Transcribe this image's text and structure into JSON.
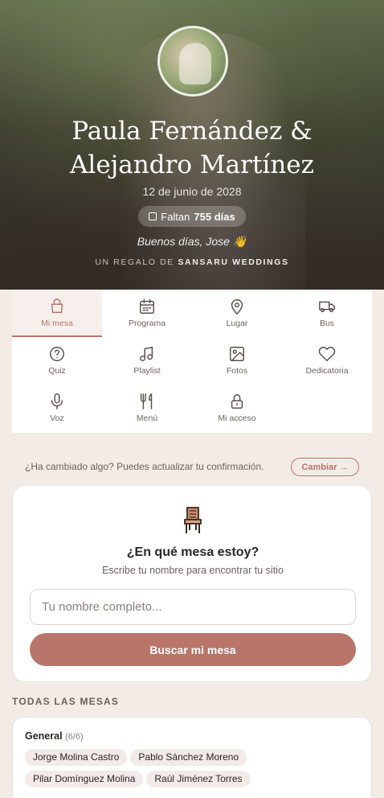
{
  "hero": {
    "couple_names": "Paula Fernández & Alejandro Martínez",
    "date": "12 de junio de 2028",
    "countdown_prefix": "Faltan",
    "countdown_value": "755 días",
    "greeting": "Buenos días, Jose 👋",
    "gift_prefix": "UN REGALO DE",
    "gift_brand": "SANSARU WEDDINGS"
  },
  "nav": {
    "items": [
      {
        "label": "Mi mesa",
        "icon": "bag-icon",
        "active": true
      },
      {
        "label": "Programa",
        "icon": "calendar-icon"
      },
      {
        "label": "Lugar",
        "icon": "map-pin-icon"
      },
      {
        "label": "Bus",
        "icon": "bus-icon"
      },
      {
        "label": "Quiz",
        "icon": "question-icon"
      },
      {
        "label": "Playlist",
        "icon": "music-icon"
      },
      {
        "label": "Fotos",
        "icon": "image-icon"
      },
      {
        "label": "Dedicatoria",
        "icon": "heart-icon"
      },
      {
        "label": "Voz",
        "icon": "microphone-icon"
      },
      {
        "label": "Menú",
        "icon": "fork-knife-icon"
      },
      {
        "label": "Mi acceso",
        "icon": "lock-icon"
      }
    ]
  },
  "update": {
    "text": "¿Ha cambiado algo? Puedes actualizar tu confirmación.",
    "button": "Cambiar →"
  },
  "finder": {
    "title": "¿En qué mesa estoy?",
    "subtitle": "Escribe tu nombre para encontrar tu sitio",
    "input_placeholder": "Tu nombre completo...",
    "input_value": "",
    "button": "Buscar mi mesa"
  },
  "tables": {
    "section_title": "TODAS LAS MESAS",
    "groups": [
      {
        "name": "General",
        "count": "(6/6)",
        "guests": [
          "Jorge Molina Castro",
          "Pablo Sánchez Moreno",
          "Pilar Domínguez Molina",
          "Raúl Jiménez Torres"
        ]
      }
    ]
  },
  "colors": {
    "accent": "#b9756a",
    "background": "#f3ebe6"
  }
}
